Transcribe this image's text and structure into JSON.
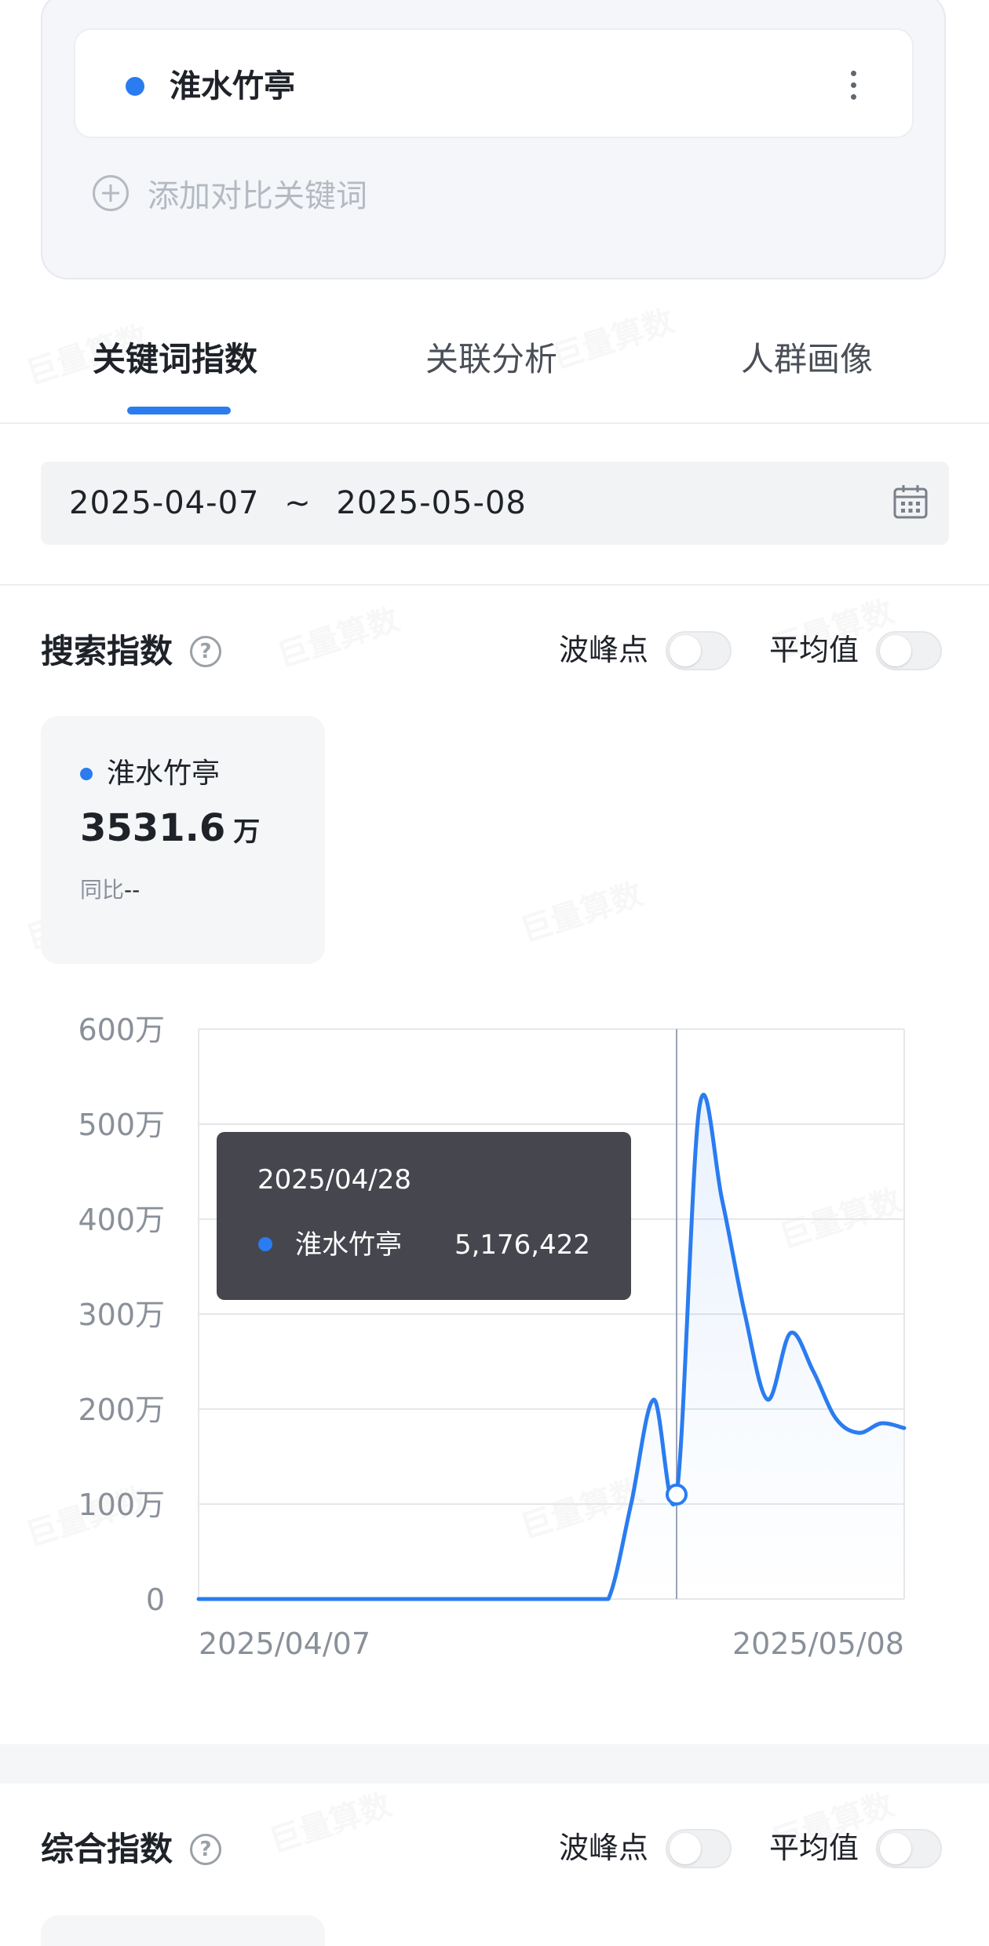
{
  "keyword_card": {
    "keyword": "淮水竹亭",
    "add_compare_label": "添加对比关键词"
  },
  "tabs": [
    {
      "label": "关键词指数",
      "active": true
    },
    {
      "label": "关联分析",
      "active": false
    },
    {
      "label": "人群画像",
      "active": false
    }
  ],
  "date_range": {
    "start": "2025-04-07",
    "separator": "~",
    "end": "2025-05-08"
  },
  "search_index": {
    "title": "搜索指数",
    "help": "?",
    "peak_label": "波峰点",
    "average_label": "平均值",
    "peak_on": false,
    "average_on": false,
    "stat": {
      "name": "淮水竹亭",
      "value": "3531.6",
      "unit": "万",
      "compare_label": "同比",
      "compare_value": "--"
    }
  },
  "composite_index": {
    "title": "综合指数",
    "help": "?",
    "peak_label": "波峰点",
    "average_label": "平均值"
  },
  "watermark_text": "巨量算数",
  "colors": {
    "accent": "#2a7cf0",
    "tooltip_bg": "#45464e",
    "grid": "#e5e7eb",
    "axis_text": "#8a9099"
  },
  "chart_data": {
    "type": "line",
    "series": [
      {
        "name": "淮水竹亭",
        "color": "#2a7cf0"
      }
    ],
    "x_tick_labels": [
      "2025/04/07",
      "2025/05/08"
    ],
    "y_tick_labels": [
      "0",
      "100万",
      "200万",
      "300万",
      "400万",
      "500万",
      "600万"
    ],
    "ylim": [
      0,
      6000000
    ],
    "x": [
      "2025/04/07",
      "2025/04/08",
      "2025/04/09",
      "2025/04/10",
      "2025/04/11",
      "2025/04/12",
      "2025/04/13",
      "2025/04/14",
      "2025/04/15",
      "2025/04/16",
      "2025/04/17",
      "2025/04/18",
      "2025/04/19",
      "2025/04/20",
      "2025/04/21",
      "2025/04/22",
      "2025/04/23",
      "2025/04/24",
      "2025/04/25",
      "2025/04/26",
      "2025/04/27",
      "2025/04/28",
      "2025/04/29",
      "2025/04/30",
      "2025/05/01",
      "2025/05/02",
      "2025/05/03",
      "2025/05/04",
      "2025/05/05",
      "2025/05/06",
      "2025/05/07",
      "2025/05/08"
    ],
    "values": [
      0,
      0,
      0,
      0,
      0,
      0,
      0,
      0,
      0,
      0,
      0,
      0,
      0,
      0,
      0,
      0,
      0,
      0,
      0,
      1000000,
      2100000,
      1100000,
      5176422,
      4200000,
      3000000,
      2100000,
      2800000,
      2400000,
      1900000,
      1750000,
      1850000,
      1800000
    ],
    "highlight_index": 21,
    "tooltip": {
      "date": "2025/04/28",
      "series_name": "淮水竹亭",
      "value_text": "5,176,422"
    },
    "grid": true
  }
}
